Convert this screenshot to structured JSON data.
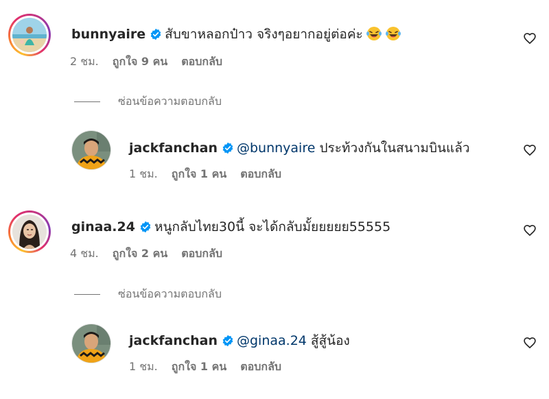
{
  "comments": [
    {
      "username": "bunnyaire",
      "text": "สับขาหลอกป๋าว จริงๆอยากอยู่ต่อค่ะ",
      "emoji": [
        "laughing-face-with-tears-emoji",
        "laughing-face-with-tears-emoji"
      ],
      "time": "2 ชม.",
      "likes": "ถูกใจ 9 คน",
      "reply": "ตอบกลับ",
      "hide_replies": "ซ่อนข้อความตอบกลับ",
      "reply_item": {
        "username": "jackfanchan",
        "mention": "@bunnyaire",
        "text": " ประท้วงกันในสนามบินแล้ว",
        "time": "1 ชม.",
        "likes": "ถูกใจ 1 คน",
        "reply": "ตอบกลับ"
      }
    },
    {
      "username": "ginaa.24",
      "text": "หนูกลับไทย30นี้ จะได้กลับมั้ยยยยย55555",
      "time": "4 ชม.",
      "likes": "ถูกใจ 2 คน",
      "reply": "ตอบกลับ",
      "hide_replies": "ซ่อนข้อความตอบกลับ",
      "reply_item": {
        "username": "jackfanchan",
        "mention": "@ginaa.24",
        "text": " สู้สู้น้อง",
        "time": "1 ชม.",
        "likes": "ถูกใจ 1 คน",
        "reply": "ตอบกลับ"
      }
    }
  ],
  "icons": {
    "verified": "verified-badge-icon",
    "like": "heart-outline-icon"
  },
  "colors": {
    "verified": "#0095f6",
    "mention": "#00376b",
    "meta": "#737373",
    "text": "#262626"
  }
}
